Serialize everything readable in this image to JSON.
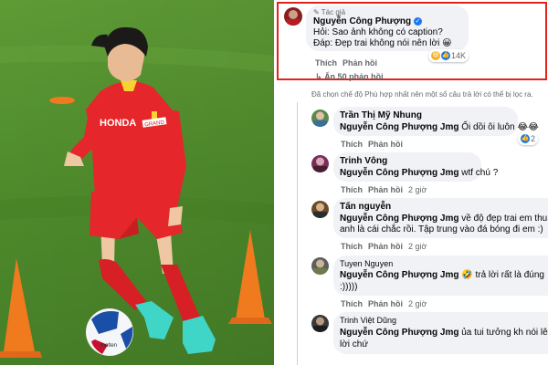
{
  "main_post_reply": {
    "author_badge": "Tác giả",
    "author": "Nguyễn Công Phượng",
    "line1": "Hỏi: Sao ảnh không có caption?",
    "line2": "Đáp: Đẹp trai không nói nên lời 😀",
    "actions": [
      "Thích",
      "Phản hồi"
    ],
    "reaction_count": "14K",
    "more_replies": "Ẩn 50 phản hồi"
  },
  "filter_note": "Đã chọn chế độ Phù hợp nhất nên một số câu trả lời có thể bị lọc ra.",
  "comments": [
    {
      "author": "Trần Thị Mỹ Nhung",
      "mention": "Nguyễn Công Phượng Jmg",
      "text": " Ối dồi ôi luôn 😂😂",
      "actions": [
        "Thích",
        "Phản hồi"
      ],
      "time": "",
      "reaction_count": "2"
    },
    {
      "author": "Trinh Vông",
      "mention": "Nguyễn Công Phượng Jmg",
      "text": " wtf chú ?",
      "actions": [
        "Thích",
        "Phản hồi"
      ],
      "time": "2 giờ"
    },
    {
      "author": "Tấn nguyễn",
      "mention": "Nguyễn Công Phượng Jmg",
      "text": " về độ đẹp trai em thu",
      "text2": "anh là cái chắc rồi. Tập trung vào đá bóng đi em :)",
      "actions": [
        "Thích",
        "Phản hồi"
      ],
      "time": "2 giờ"
    },
    {
      "author": "Tuyen Nguyen",
      "mention": "Nguyễn Công Phượng Jmg",
      "text": " 🤣 trả lời rất là đúng",
      "text2": ":)))))",
      "actions": [
        "Thích",
        "Phản hồi"
      ],
      "time": "2 giờ"
    },
    {
      "author": "Trinh Việt Dũng",
      "mention": "Nguyễn Công Phượng Jmg",
      "text": " ủa tui tưởng kh nói lê",
      "text2": "lời chứ",
      "actions": [],
      "time": ""
    }
  ],
  "jersey": {
    "sponsor": "HONDA",
    "sleeve": "GRAND"
  },
  "colors": {
    "highlight": "#e2231a",
    "grass": "#4f8a2e",
    "jersey": "#e5262a",
    "cone": "#f07a1e",
    "verified": "#1877f2"
  }
}
